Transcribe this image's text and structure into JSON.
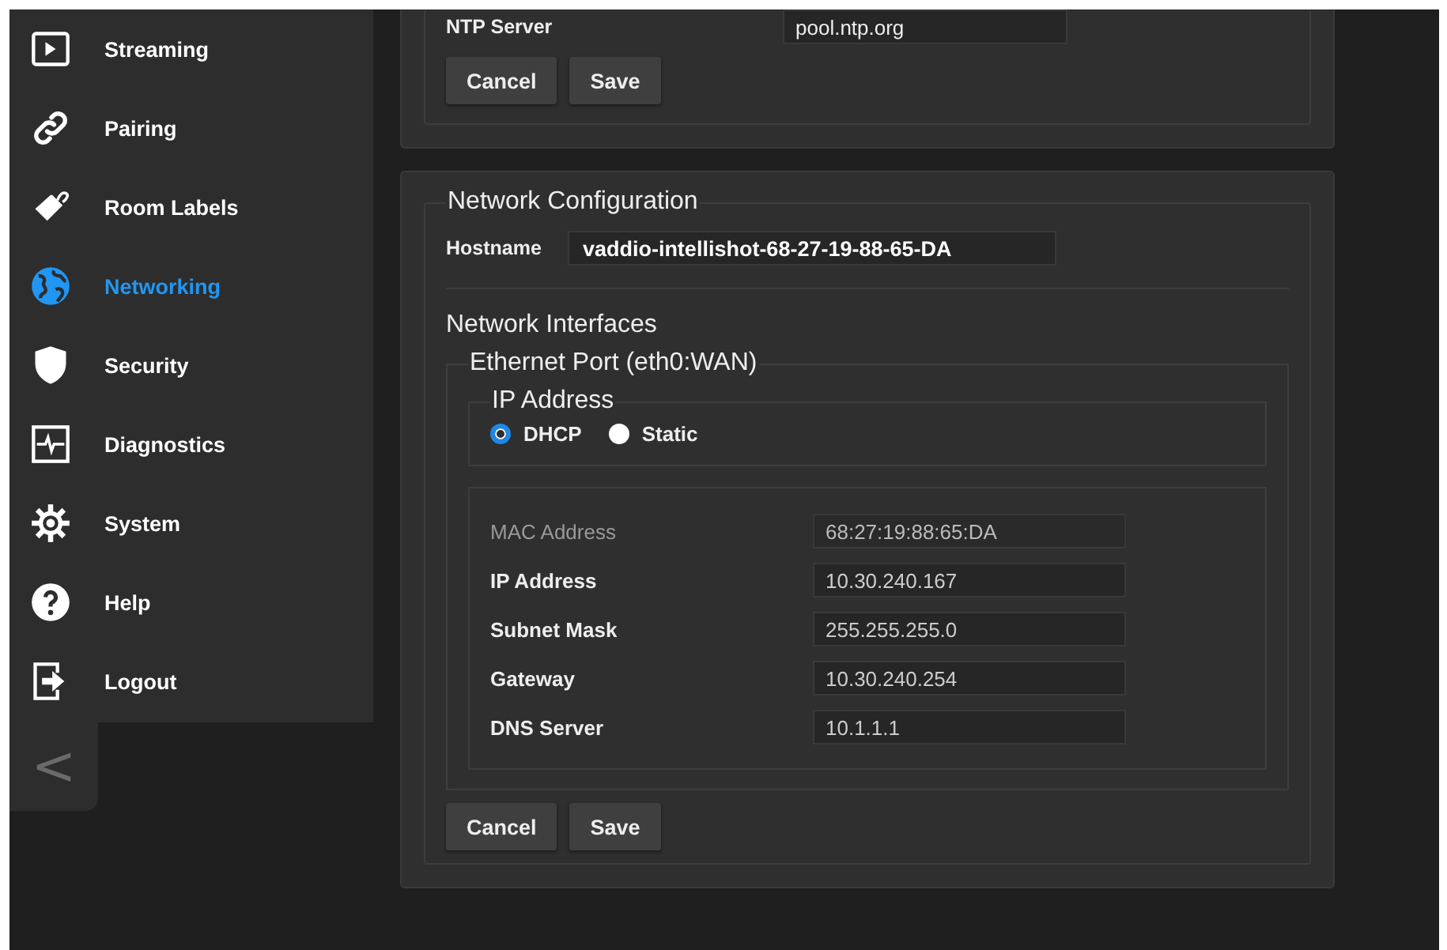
{
  "sidebar": {
    "items": [
      {
        "label": "Streaming",
        "selected": false
      },
      {
        "label": "Pairing",
        "selected": false
      },
      {
        "label": "Room Labels",
        "selected": false
      },
      {
        "label": "Networking",
        "selected": true
      },
      {
        "label": "Security",
        "selected": false
      },
      {
        "label": "Diagnostics",
        "selected": false
      },
      {
        "label": "System",
        "selected": false
      },
      {
        "label": "Help",
        "selected": false
      },
      {
        "label": "Logout",
        "selected": false
      }
    ],
    "collapse_button": "<"
  },
  "ntp_section": {
    "label": "NTP Server",
    "value": "pool.ntp.org",
    "buttons": [
      "Cancel",
      "Save"
    ]
  },
  "network_configuration": {
    "title": "Network Configuration",
    "hostname": {
      "label": "Hostname",
      "value": "vaddio-intellishot-68-27-19-88-65-DA"
    },
    "interfaces_title": "Network Interfaces",
    "port": {
      "title": "Ethernet Port (eth0:WAN)",
      "ip_address": {
        "title": "IP Address",
        "options": [
          {
            "label": "DHCP",
            "selected": true
          },
          {
            "label": "Static",
            "selected": false
          }
        ]
      },
      "fields": [
        {
          "label": "MAC Address",
          "value": "68:27:19:88:65:DA",
          "disabled": true
        },
        {
          "label": "IP Address",
          "value": "10.30.240.167",
          "disabled": false
        },
        {
          "label": "Subnet Mask",
          "value": "255.255.255.0",
          "disabled": false
        },
        {
          "label": "Gateway",
          "value": "10.30.240.254",
          "disabled": false
        },
        {
          "label": "DNS Server",
          "value": "10.1.1.1",
          "disabled": false
        }
      ]
    },
    "buttons": [
      "Cancel",
      "Save"
    ]
  }
}
